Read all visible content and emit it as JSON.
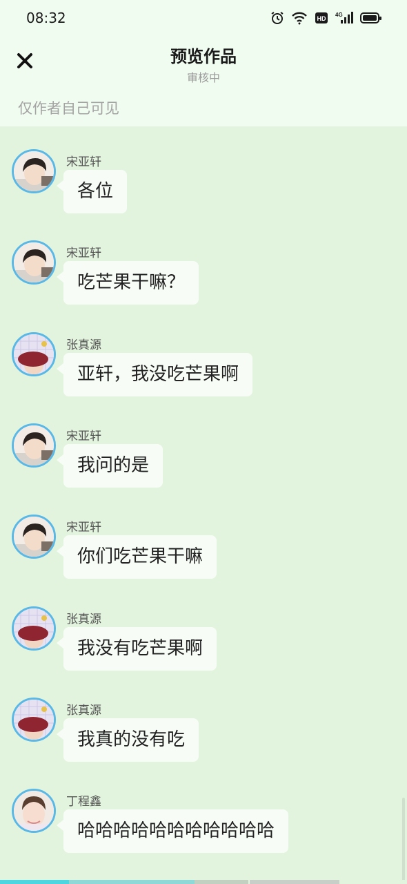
{
  "status_bar": {
    "time": "08:32"
  },
  "header": {
    "title": "预览作品",
    "subtitle": "审核中"
  },
  "visibility_note": "仅作者自己可见",
  "messages": [
    {
      "sender": "宋亚轩",
      "text": "各位",
      "avatar": "avatar-songyaxuan"
    },
    {
      "sender": "宋亚轩",
      "text": "吃芒果干嘛？",
      "avatar": "avatar-songyaxuan"
    },
    {
      "sender": "张真源",
      "text": "亚轩，我没吃芒果啊",
      "avatar": "avatar-zhangzhenyuan"
    },
    {
      "sender": "宋亚轩",
      "text": "我问的是",
      "avatar": "avatar-songyaxuan"
    },
    {
      "sender": "宋亚轩",
      "text": "你们吃芒果干嘛",
      "avatar": "avatar-songyaxuan"
    },
    {
      "sender": "张真源",
      "text": "我没有吃芒果啊",
      "avatar": "avatar-zhangzhenyuan"
    },
    {
      "sender": "张真源",
      "text": "我真的没有吃",
      "avatar": "avatar-zhangzhenyuan"
    },
    {
      "sender": "丁程鑫",
      "text": "哈哈哈哈哈哈哈哈哈哈哈",
      "avatar": "avatar-dingchengxin"
    }
  ],
  "colors": {
    "background": "#e3f4de",
    "header_bg": "#f1fcf0",
    "bubble": "#f7fdf6",
    "avatar_ring": "#5ab8e6",
    "progress_accent": "#4dd6e0"
  },
  "icons": [
    "close-icon",
    "alarm-icon",
    "wifi-icon",
    "hd-icon",
    "4g-signal-icon",
    "battery-icon"
  ]
}
